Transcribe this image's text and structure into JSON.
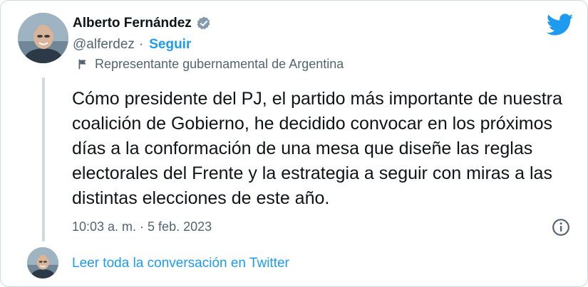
{
  "author": {
    "name": "Alberto Fernández",
    "handle": "@alferdez",
    "separator": "·",
    "follow_label": "Seguir",
    "label": "Representante gubernamental de Argentina"
  },
  "tweet": {
    "text": "Cómo presidente del PJ, el partido más importante de nuestra coalición de Gobierno, he decidido convocar en los próximos días a la conformación de una mesa que diseñe las reglas electorales del Frente y la estrategia a seguir con miras a las distintas elecciones de este año.",
    "timestamp": "10:03 a. m. · 5 feb. 2023"
  },
  "footer": {
    "read_conversation": "Leer toda la conversación en Twitter"
  },
  "icons": {
    "verified": "verified-badge-icon",
    "twitter": "twitter-bird-icon",
    "flag": "flag-icon",
    "info": "info-icon"
  },
  "colors": {
    "accent": "#1d9bf0",
    "text": "#0f1419",
    "secondary": "#536471",
    "border": "#cfd9de"
  }
}
